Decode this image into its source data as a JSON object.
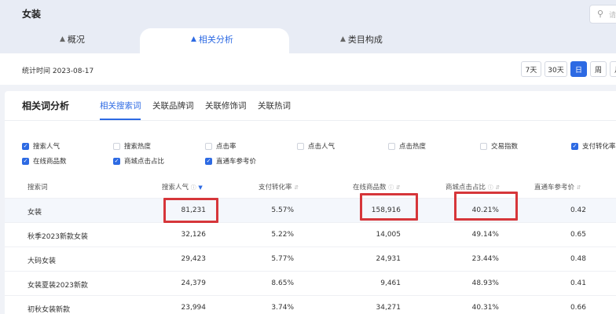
{
  "header": {
    "category_title": "女装",
    "search_placeholder": "请",
    "nav_tabs": [
      {
        "label": "概况",
        "active": false
      },
      {
        "label": "相关分析",
        "active": true
      },
      {
        "label": "类目构成",
        "active": false
      }
    ],
    "stat_time": "统计时间 2023-08-17",
    "periods": [
      {
        "label": "7天",
        "active": false
      },
      {
        "label": "30天",
        "active": false
      },
      {
        "label": "日",
        "active": true
      },
      {
        "label": "周",
        "active": false
      },
      {
        "label": "月",
        "active": false
      }
    ]
  },
  "analysis": {
    "title": "相关词分析",
    "tabs": [
      {
        "label": "相关搜索词",
        "active": true
      },
      {
        "label": "关联品牌词",
        "active": false
      },
      {
        "label": "关联修饰词",
        "active": false
      },
      {
        "label": "关联热词",
        "active": false
      }
    ],
    "metrics": [
      {
        "label": "搜索人气",
        "checked": true
      },
      {
        "label": "搜索热度",
        "checked": false
      },
      {
        "label": "点击率",
        "checked": false
      },
      {
        "label": "点击人气",
        "checked": false
      },
      {
        "label": "点击热度",
        "checked": false
      },
      {
        "label": "交易指数",
        "checked": false
      },
      {
        "label": "支付转化率",
        "checked": true
      },
      {
        "label": "在线商品数",
        "checked": true
      },
      {
        "label": "商城点击占比",
        "checked": true
      },
      {
        "label": "直通车参考价",
        "checked": true
      }
    ]
  },
  "table": {
    "columns": [
      "搜索词",
      "搜索人气",
      "支付转化率",
      "在线商品数",
      "商城点击占比",
      "直通车参考价"
    ],
    "rows": [
      [
        "女装",
        "81,231",
        "5.57%",
        "158,916",
        "40.21%",
        "0.42"
      ],
      [
        "秋季2023新款女装",
        "32,126",
        "5.22%",
        "14,005",
        "49.14%",
        "0.65"
      ],
      [
        "大码女装",
        "29,423",
        "5.77%",
        "24,931",
        "23.44%",
        "0.48"
      ],
      [
        "女装夏装2023新款",
        "24,379",
        "8.65%",
        "9,461",
        "48.93%",
        "0.41"
      ],
      [
        "初秋女装新款",
        "23,994",
        "3.74%",
        "34,271",
        "40.31%",
        "0.66"
      ]
    ]
  },
  "colors": {
    "accent": "#2d6ae3",
    "highlight": "#d6363a"
  }
}
